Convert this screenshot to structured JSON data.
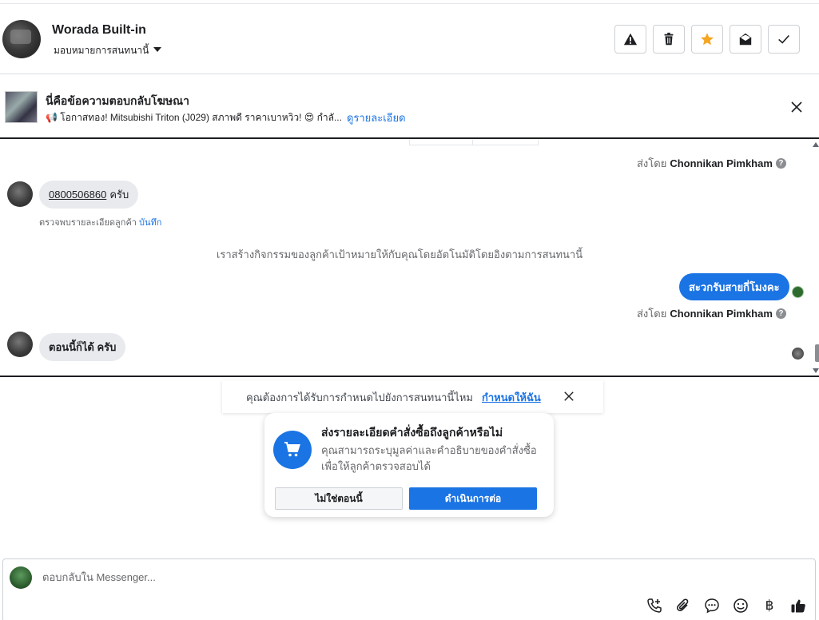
{
  "header": {
    "contact_name": "Worada Built-in",
    "assign_label": "มอบหมายการสนทนานี้",
    "actions": [
      {
        "name": "report-button",
        "icon": "warning-icon"
      },
      {
        "name": "delete-button",
        "icon": "trash-icon"
      },
      {
        "name": "star-button",
        "icon": "star-icon",
        "color": "#f5a623"
      },
      {
        "name": "mark-unread-button",
        "icon": "envelope-open-icon"
      },
      {
        "name": "done-button",
        "icon": "check-icon"
      }
    ]
  },
  "ad_banner": {
    "title": "นี่คือข้อความตอบกลับโฆษณา",
    "description": "📢 โอกาสทอง! Mitsubishi Triton (J029) สภาพดี ราคาเบาหวิว! 😍 กำลั...",
    "link": "ดูรายละเอียด"
  },
  "conversation": {
    "sent_by_prefix": "ส่งโดย",
    "sent_by_name": "Chonnikan Pimkham",
    "msg1_phone": "0800506860",
    "msg1_suffix": "ครับ",
    "detected_text": "ตรวจพบรายละเอียดลูกค้า",
    "detected_link": "บันทึก",
    "system_message": "เราสร้างกิจกรรมของลูกค้าเป้าหมายให้กับคุณโดยอัตโนมัติโดยอิงตามการสนทนานี้",
    "outgoing_message": "สะวกรับสายกี่โมงคะ",
    "msg2": "ตอนนี้ก็ได้ ครับ"
  },
  "reminder": {
    "text": "คุณต้องการได้รับการกำหนดไปยังการสนทนานี้ไหม",
    "link": "กำหนดให้ฉัน"
  },
  "order_card": {
    "title": "ส่งรายละเอียดคำสั่งซื้อถึงลูกค้าหรือไม่",
    "description": "คุณสามารถระบุมูลค่าและคำอธิบายของคำสั่งซื้อเพื่อให้ลูกค้าตรวจสอบได้",
    "decline_label": "ไม่ใช่ตอนนี้",
    "confirm_label": "ดำเนินการต่อ"
  },
  "composer": {
    "placeholder": "ตอบกลับใน Messenger...",
    "baht_symbol": "฿",
    "tools": [
      "call-add-icon",
      "paperclip-icon",
      "chat-bubble-icon",
      "emoji-icon",
      "baht-icon",
      "thumbs-up-icon"
    ]
  },
  "colors": {
    "accent": "#1b74e4",
    "star": "#f5a623",
    "bubble_in": "#e9eaed"
  }
}
